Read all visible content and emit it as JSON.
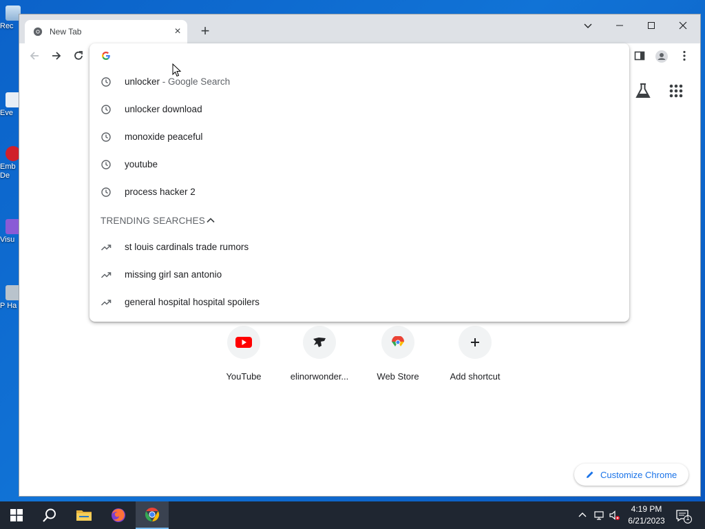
{
  "desktop": {
    "icons": [
      {
        "label": "Rec"
      },
      {
        "label": "Eve"
      },
      {
        "label": "Emb De"
      },
      {
        "label": "Visu"
      },
      {
        "label": "P Ha"
      }
    ]
  },
  "browser": {
    "tab": {
      "title": "New Tab",
      "close_glyph": "×"
    },
    "new_tab_glyph": "+",
    "window_controls": [
      "chevron-down-icon",
      "minimize-icon",
      "maximize-icon",
      "close-icon"
    ]
  },
  "omnibox": {
    "value": "",
    "suggestions": [
      {
        "text": "unlocker",
        "suffix": " - Google Search",
        "icon": "history-icon"
      },
      {
        "text": "unlocker download",
        "suffix": "",
        "icon": "history-icon"
      },
      {
        "text": "monoxide peaceful",
        "suffix": "",
        "icon": "history-icon"
      },
      {
        "text": "youtube",
        "suffix": "",
        "icon": "history-icon"
      },
      {
        "text": "process hacker 2",
        "suffix": "",
        "icon": "history-icon"
      }
    ],
    "trending_header": "TRENDING SEARCHES",
    "trending": [
      {
        "text": "st louis cardinals trade rumors",
        "icon": "trending-icon"
      },
      {
        "text": "missing girl san antonio",
        "icon": "trending-icon"
      },
      {
        "text": "general hospital hospital spoilers",
        "icon": "trending-icon"
      }
    ]
  },
  "ntp": {
    "shortcuts": [
      {
        "label": "YouTube",
        "icon": "youtube-icon"
      },
      {
        "label": "elinorwonder...",
        "icon": "site-icon"
      },
      {
        "label": "Web Store",
        "icon": "webstore-icon"
      },
      {
        "label": "Add shortcut",
        "icon": "plus-icon"
      }
    ],
    "customize_label": "Customize Chrome"
  },
  "taskbar": {
    "time": "4:19 PM",
    "date": "6/21/2023",
    "notification_count": "1"
  },
  "colors": {
    "accent": "#1a73e8",
    "tabstrip": "#dee1e6",
    "taskbar": "#1f2631"
  }
}
